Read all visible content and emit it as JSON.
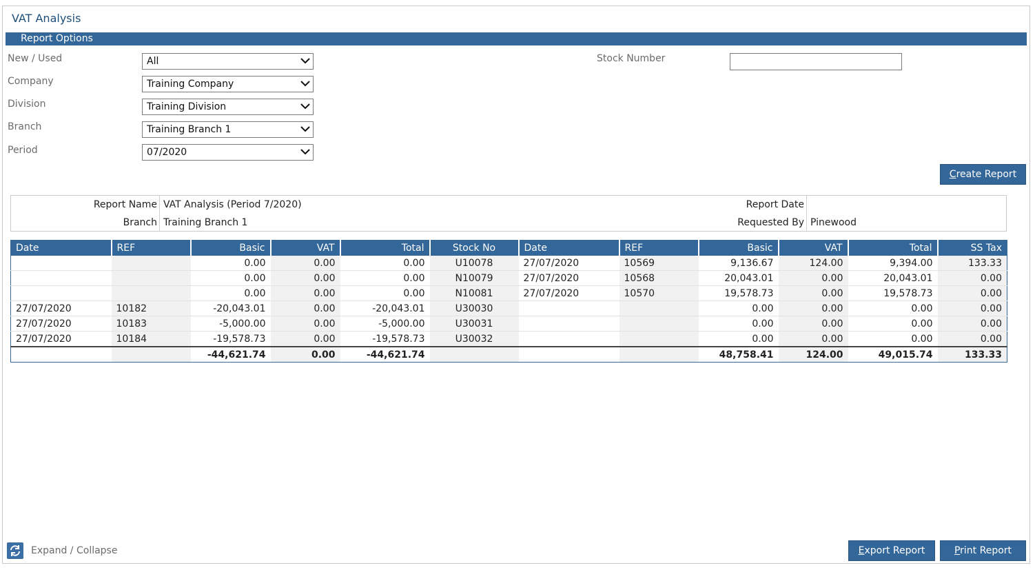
{
  "window": {
    "title": "VAT Analysis"
  },
  "report_options": {
    "header": "Report Options",
    "fields": [
      {
        "label": "New / Used",
        "value": "All"
      },
      {
        "label": "Company",
        "value": "Training Company"
      },
      {
        "label": "Division",
        "value": "Training Division"
      },
      {
        "label": "Branch",
        "value": "Training Branch 1"
      },
      {
        "label": "Period",
        "value": "07/2020"
      }
    ],
    "stock_number": {
      "label": "Stock Number",
      "value": ""
    },
    "create_button": {
      "accel": "C",
      "rest": "reate Report"
    }
  },
  "report_meta": {
    "report_name_label": "Report Name",
    "report_name_value": "VAT Analysis (Period 7/2020)",
    "branch_label": "Branch",
    "branch_value": "Training Branch 1",
    "report_date_label": "Report Date",
    "report_date_value": "",
    "requested_by_label": "Requested By",
    "requested_by_value": "Pinewood"
  },
  "grid": {
    "columns": [
      "Date",
      "REF",
      "Basic",
      "VAT",
      "Total",
      "Stock No",
      "Date",
      "REF",
      "Basic",
      "VAT",
      "Total",
      "SS Tax"
    ],
    "rows": [
      [
        "",
        "",
        "0.00",
        "0.00",
        "0.00",
        "U10078",
        "27/07/2020",
        "10569",
        "9,136.67",
        "124.00",
        "9,394.00",
        "133.33"
      ],
      [
        "",
        "",
        "0.00",
        "0.00",
        "0.00",
        "N10079",
        "27/07/2020",
        "10568",
        "20,043.01",
        "0.00",
        "20,043.01",
        "0.00"
      ],
      [
        "",
        "",
        "0.00",
        "0.00",
        "0.00",
        "N10081",
        "27/07/2020",
        "10570",
        "19,578.73",
        "0.00",
        "19,578.73",
        "0.00"
      ],
      [
        "27/07/2020",
        "10182",
        "-20,043.01",
        "0.00",
        "-20,043.01",
        "U30030",
        "",
        "",
        "0.00",
        "0.00",
        "0.00",
        "0.00"
      ],
      [
        "27/07/2020",
        "10183",
        "-5,000.00",
        "0.00",
        "-5,000.00",
        "U30031",
        "",
        "",
        "0.00",
        "0.00",
        "0.00",
        "0.00"
      ],
      [
        "27/07/2020",
        "10184",
        "-19,578.73",
        "0.00",
        "-19,578.73",
        "U30032",
        "",
        "",
        "0.00",
        "0.00",
        "0.00",
        "0.00"
      ]
    ],
    "totals": [
      "",
      "",
      "-44,621.74",
      "0.00",
      "-44,621.74",
      "",
      "",
      "",
      "48,758.41",
      "124.00",
      "49,015.74",
      "133.33"
    ]
  },
  "footer": {
    "expand_label": "Expand / Collapse",
    "export_button": {
      "accel": "E",
      "rest": "xport Report"
    },
    "print_button": {
      "accel": "P",
      "rest": "rint Report"
    }
  },
  "colors": {
    "accent": "#336699",
    "title": "#1f4e79"
  },
  "icons": {
    "dropdown": "chevron-down-icon",
    "expand": "refresh-icon"
  }
}
